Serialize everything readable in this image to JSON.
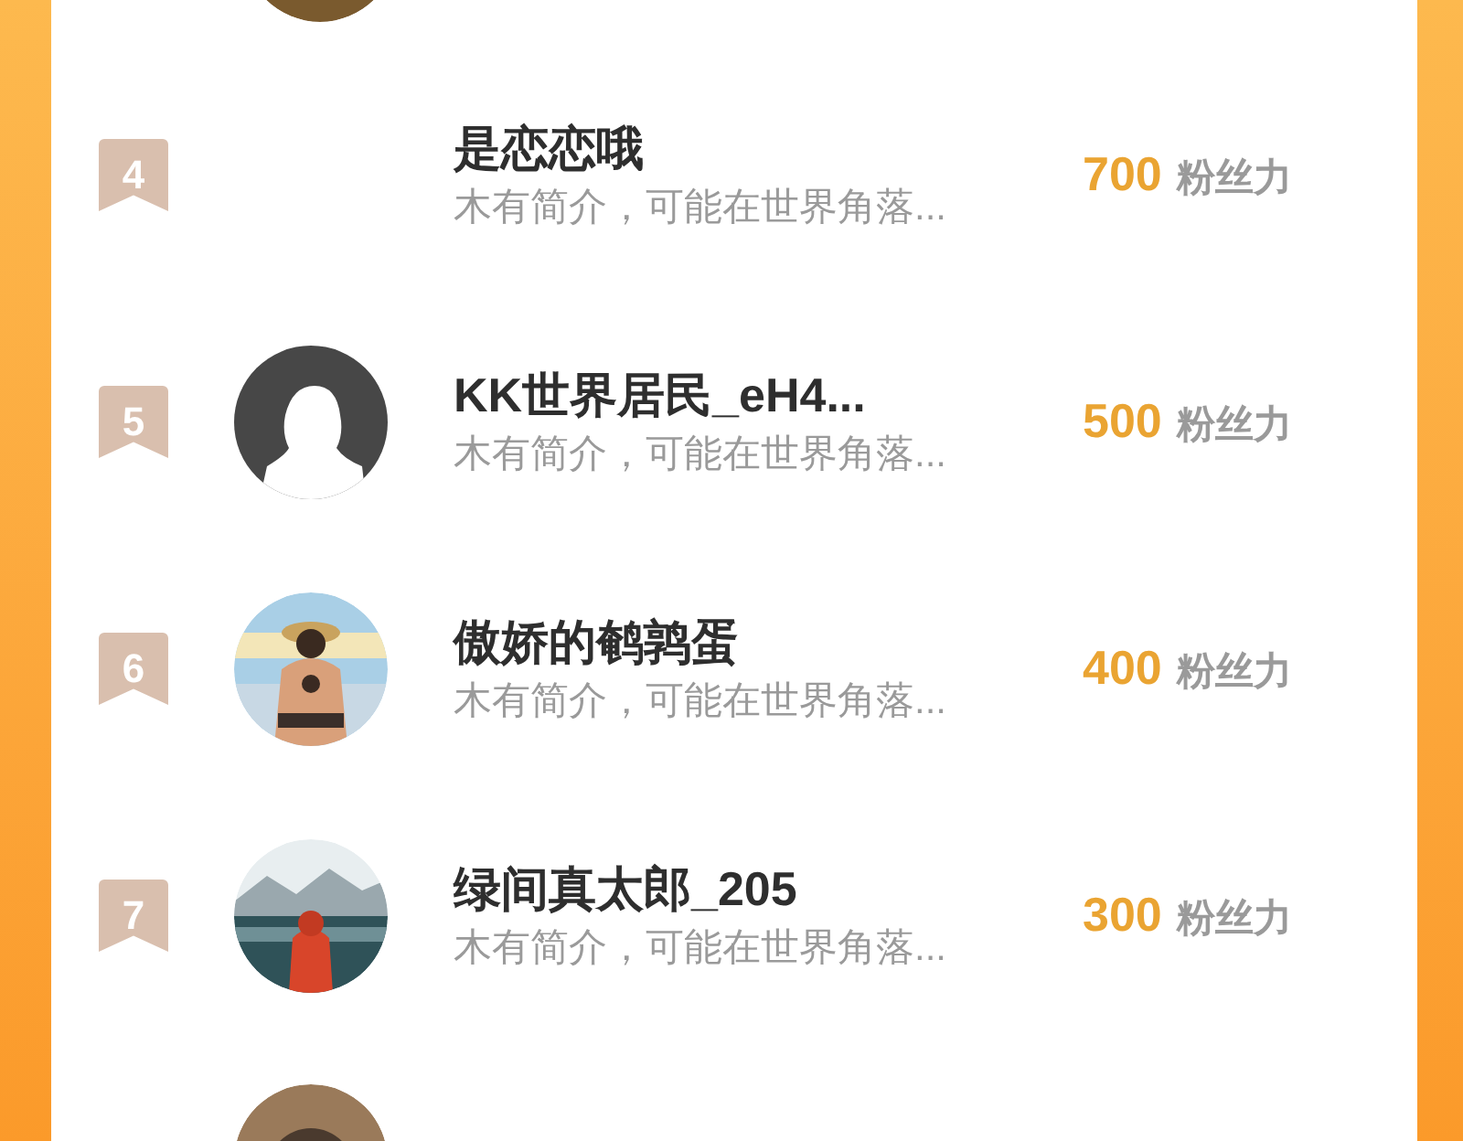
{
  "rows": [
    {
      "rank": "4",
      "name": "是恋恋哦",
      "bio": "木有简介，可能在世界角落...",
      "count": "700",
      "unit": "粉丝力"
    },
    {
      "rank": "5",
      "avatar": {
        "kind": "default"
      },
      "name": "KK世界居民_eH4...",
      "bio": "木有简介，可能在世界角落...",
      "count": "500",
      "unit": "粉丝力"
    },
    {
      "rank": "6",
      "name": "傲娇的鹌鹑蛋",
      "bio": "木有简介，可能在世界角落...",
      "count": "400",
      "unit": "粉丝力"
    },
    {
      "rank": "7",
      "name": "绿间真太郎_205",
      "bio": "木有简介，可能在世界角落...",
      "count": "300",
      "unit": "粉丝力"
    }
  ]
}
